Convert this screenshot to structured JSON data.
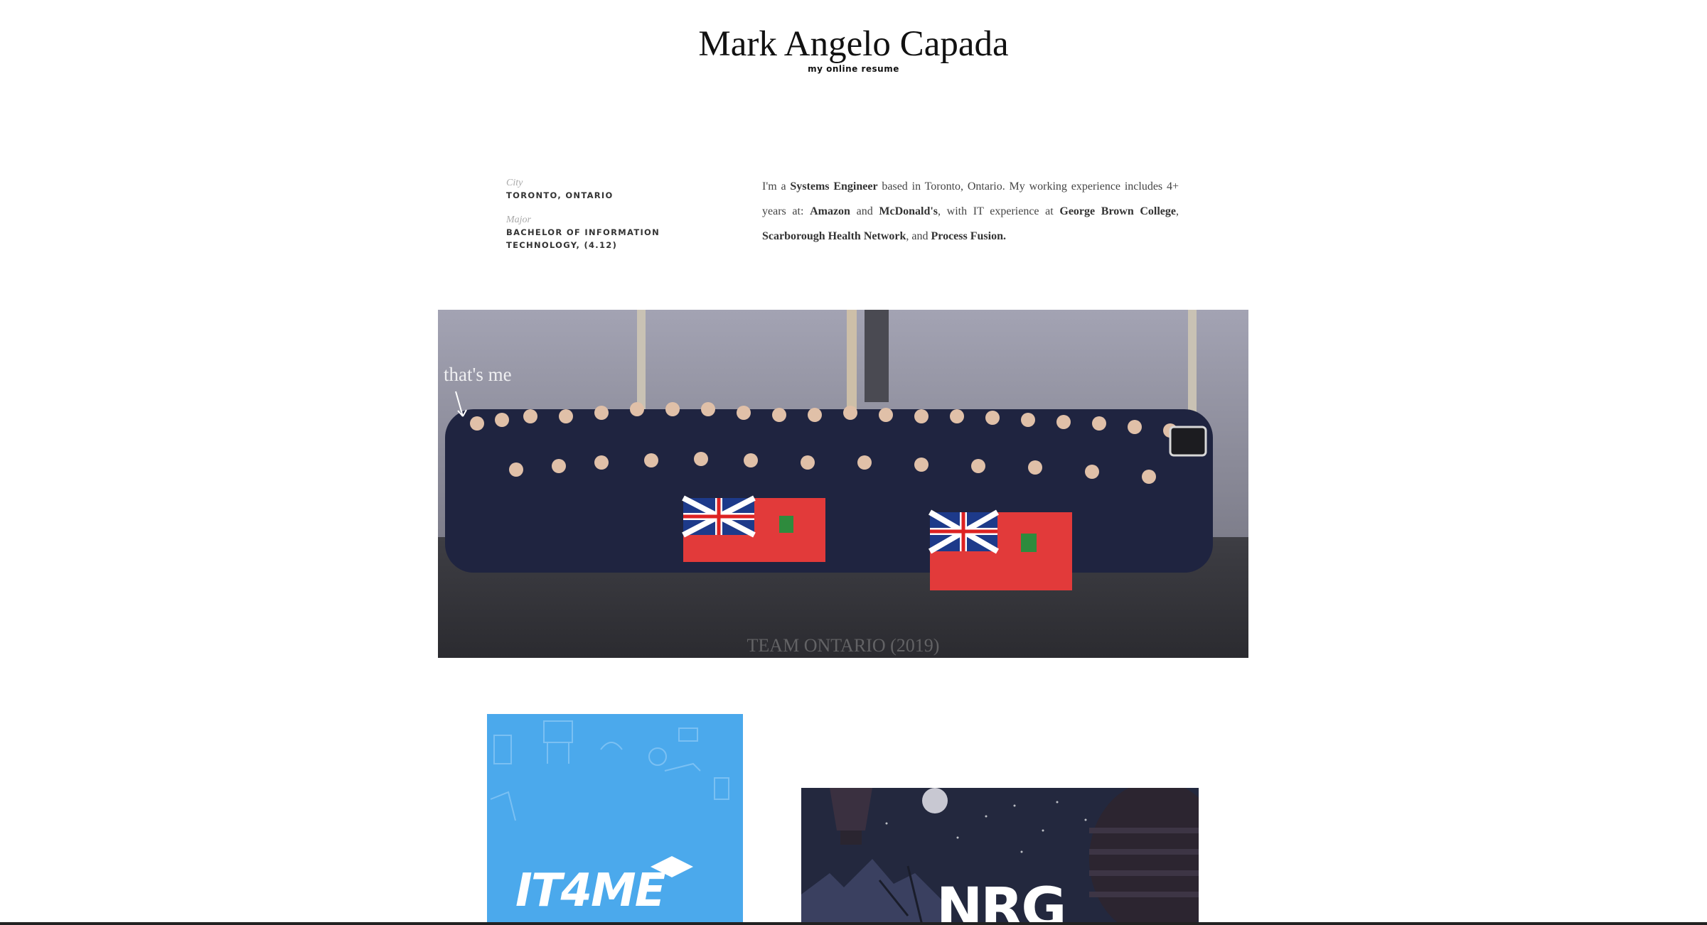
{
  "header": {
    "title": "Mark Angelo Capada",
    "tagline": "my online resume"
  },
  "info": {
    "city_label": "City",
    "city_value": "TORONTO, ONTARIO",
    "major_label": "Major",
    "major_value": "BACHELOR OF INFORMATION TECHNOLOGY, (4.12)"
  },
  "bio": {
    "p1": "I'm a ",
    "role": "Systems Engineer",
    "p2": " based in Toronto, Ontario. My working experience includes 4+ years at: ",
    "company1": "Amazon",
    "p3": " and ",
    "company2": "McDonald's",
    "p4": ", with IT experience at ",
    "company3": "George Brown College",
    "p5": ", ",
    "company4": "Scarborough Health Network",
    "p6": ", and ",
    "company5": "Process Fusion."
  },
  "photo": {
    "annotation": "that's me",
    "caption": "TEAM ONTARIO (2019)"
  },
  "projects": [
    {
      "logo": "IT4ME",
      "color": "#4ba9ec"
    },
    {
      "logo": "NRG",
      "color": "#23283e"
    }
  ]
}
